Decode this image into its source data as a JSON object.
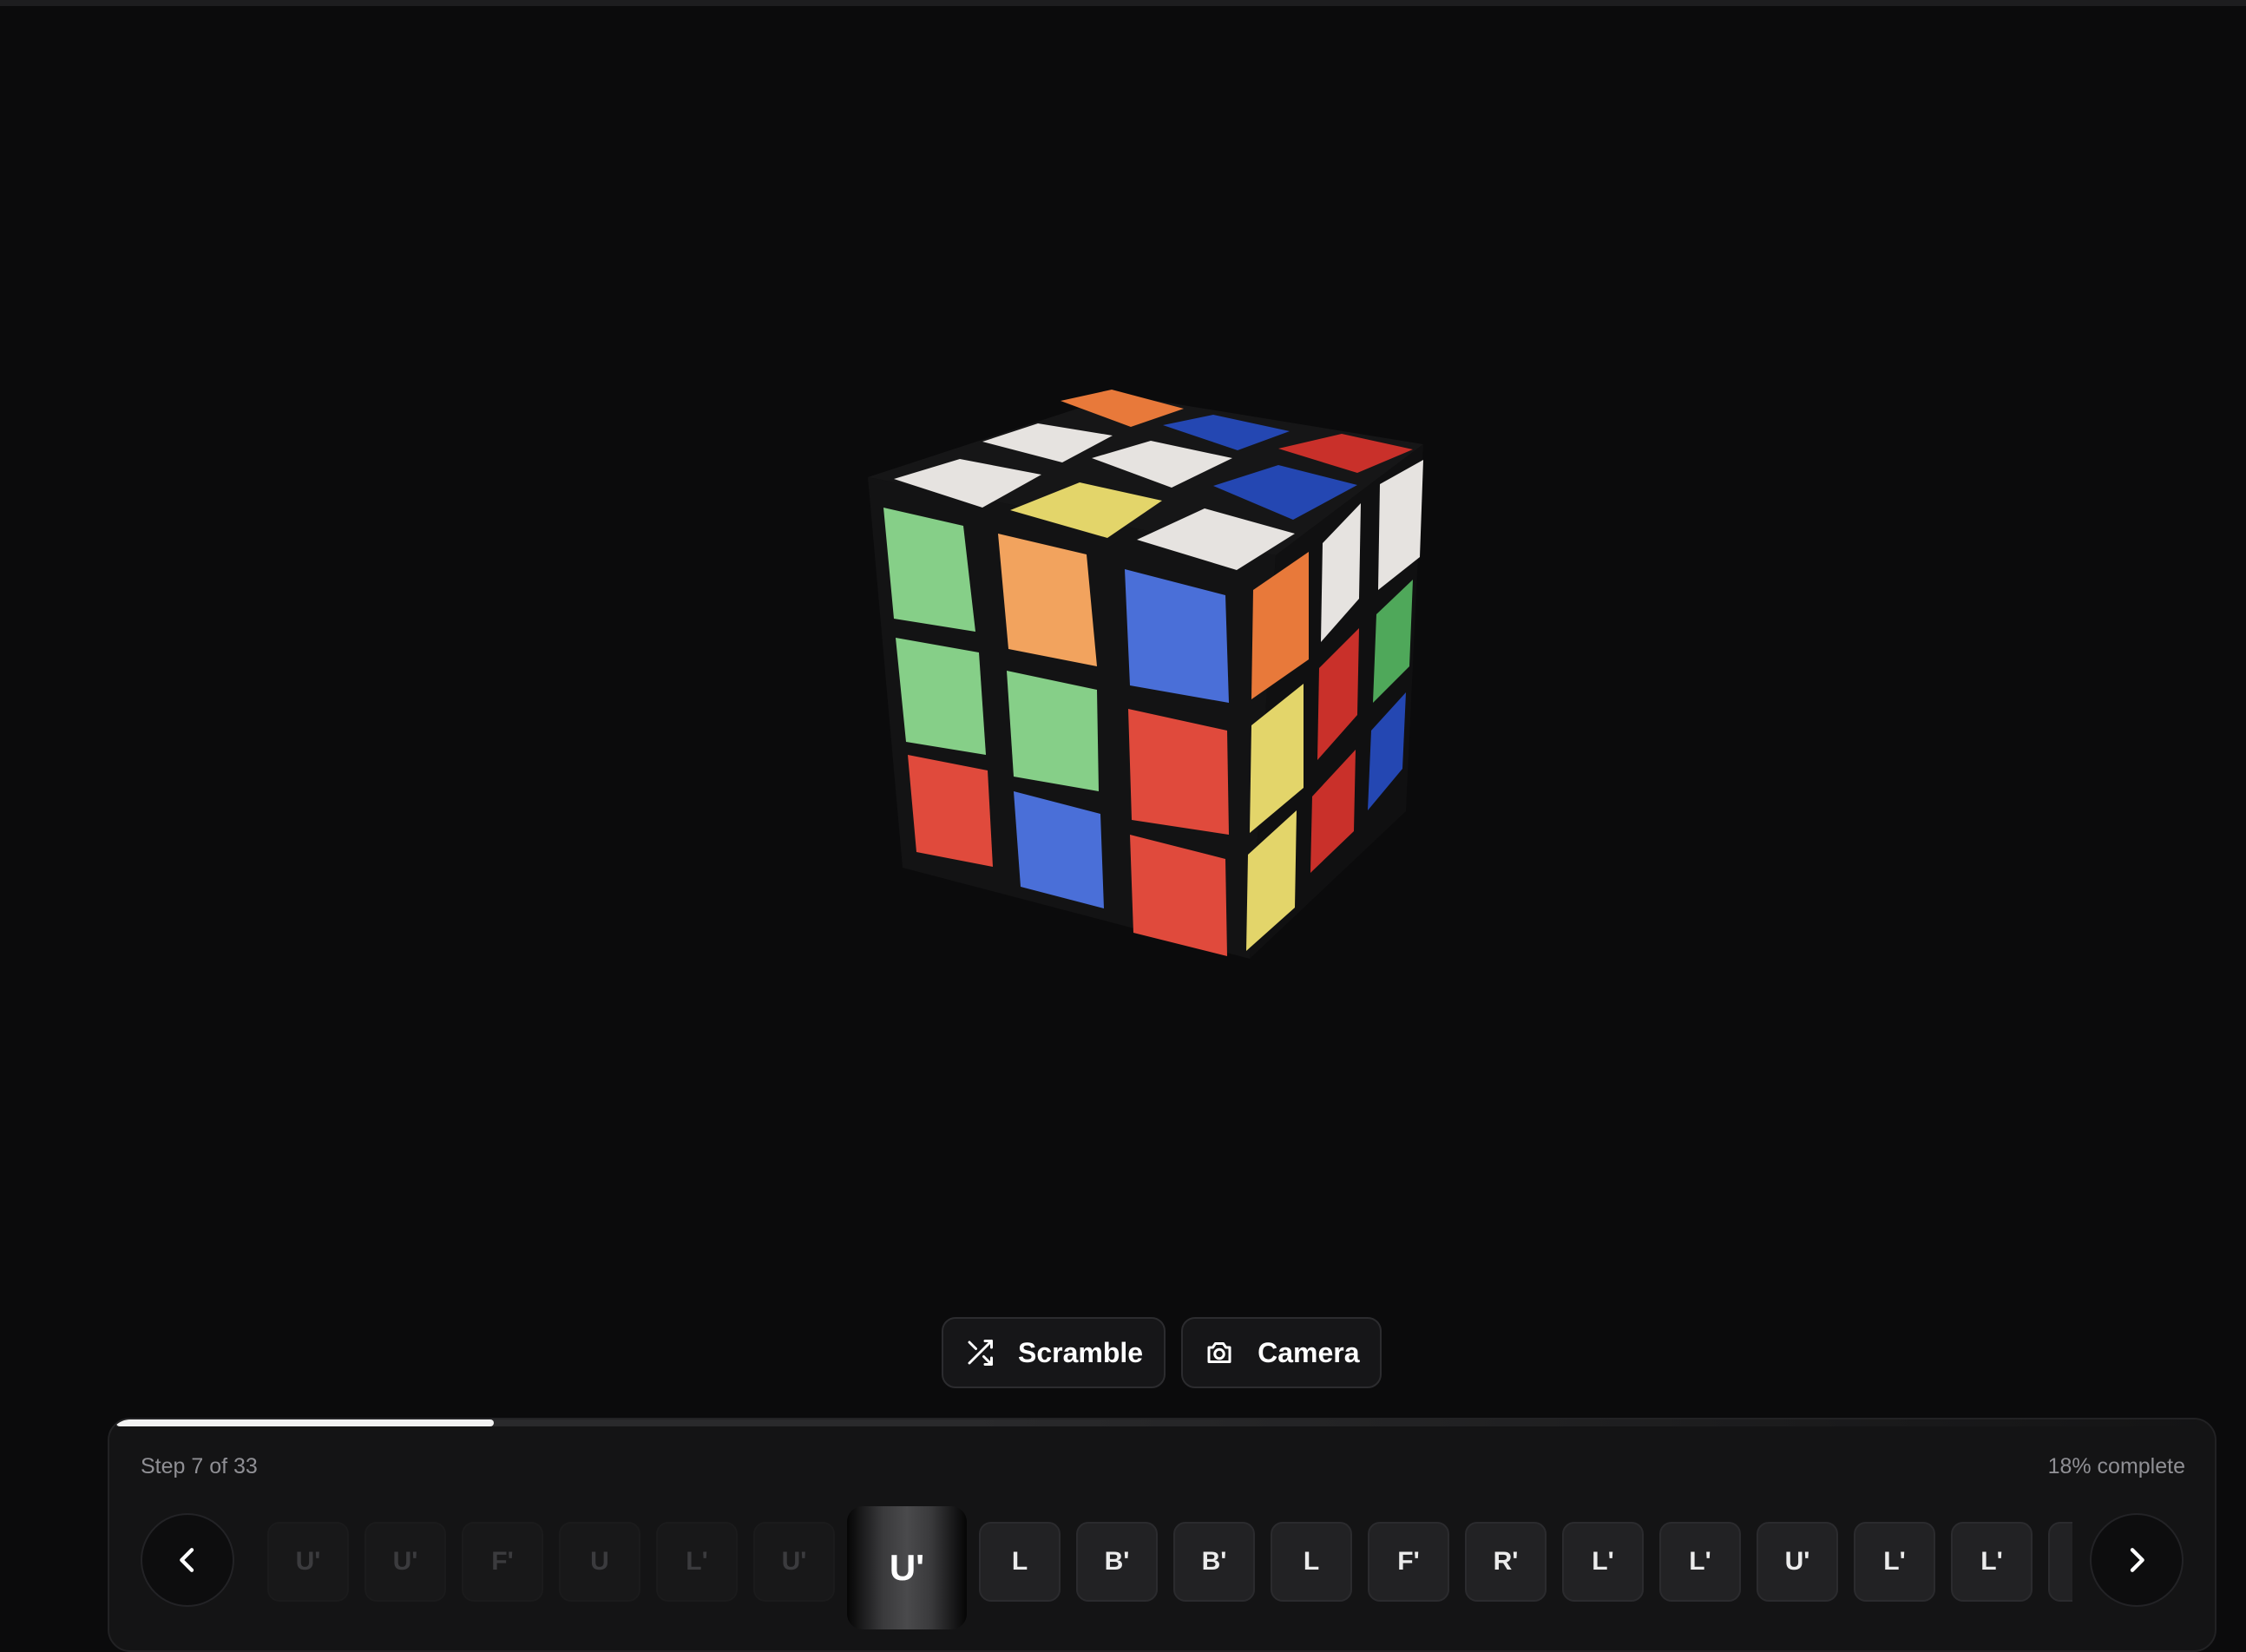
{
  "colors": {
    "background": "#0b0b0c",
    "cube_white": "#e8e6e3",
    "cube_yellow": "#e3d56a",
    "cube_red": "#e04a3c",
    "cube_orange": "#f2a35e",
    "cube_blue": "#4a6fd8",
    "cube_green": "#86cf88"
  },
  "toolbar": {
    "scramble_label": "Scramble",
    "scramble_icon": "shuffle-icon",
    "camera_label": "Camera",
    "camera_icon": "camera-icon"
  },
  "progress": {
    "fraction": 0.18,
    "step_text": "Step 7 of 33",
    "percent_text": "18% complete"
  },
  "nav": {
    "prev_icon": "chevron-left-icon",
    "next_icon": "chevron-right-icon"
  },
  "moves": [
    {
      "label": "U'",
      "state": "done"
    },
    {
      "label": "U'",
      "state": "done"
    },
    {
      "label": "F'",
      "state": "done"
    },
    {
      "label": "U",
      "state": "done"
    },
    {
      "label": "L'",
      "state": "done"
    },
    {
      "label": "U'",
      "state": "done"
    },
    {
      "label": "U'",
      "state": "active"
    },
    {
      "label": "L",
      "state": "pending"
    },
    {
      "label": "B'",
      "state": "pending"
    },
    {
      "label": "B'",
      "state": "pending"
    },
    {
      "label": "L",
      "state": "pending"
    },
    {
      "label": "F'",
      "state": "pending"
    },
    {
      "label": "R'",
      "state": "pending"
    },
    {
      "label": "L'",
      "state": "pending"
    },
    {
      "label": "L'",
      "state": "pending"
    },
    {
      "label": "U'",
      "state": "pending"
    },
    {
      "label": "L'",
      "state": "pending"
    },
    {
      "label": "L'",
      "state": "pending"
    },
    {
      "label": "",
      "state": "pending"
    }
  ]
}
